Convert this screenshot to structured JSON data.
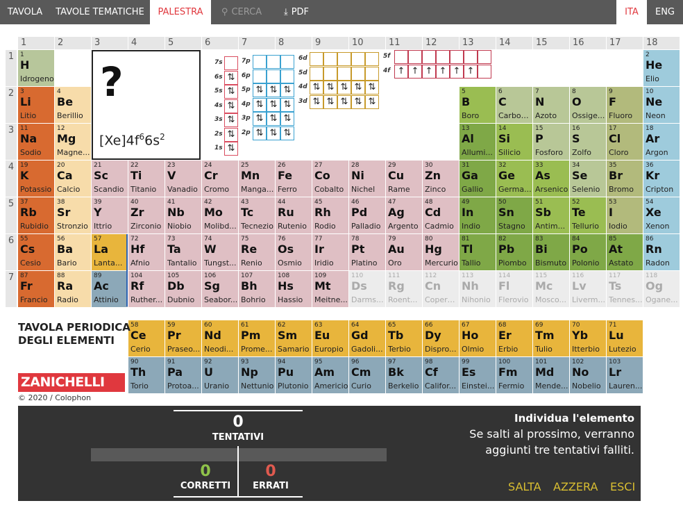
{
  "nav": {
    "items": [
      {
        "label": "TAVOLA"
      },
      {
        "label": "TAVOLE TEMATICHE"
      },
      {
        "label": "PALESTRA"
      },
      {
        "label": "CERCA"
      },
      {
        "label": "PDF"
      }
    ],
    "lang": [
      "ITA",
      "ENG"
    ]
  },
  "columns": [
    "1",
    "2",
    "3",
    "4",
    "5",
    "6",
    "7",
    "8",
    "9",
    "10",
    "11",
    "12",
    "13",
    "14",
    "15",
    "16",
    "17",
    "18"
  ],
  "rows": [
    "1",
    "2",
    "3",
    "4",
    "5",
    "6",
    "7"
  ],
  "question": {
    "mark": "?",
    "config": "[Xe]4f",
    "config_sup1": "6",
    "config_mid": "6s",
    "config_sup2": "2"
  },
  "orbitals": {
    "s": [
      "7s",
      "6s",
      "5s",
      "4s",
      "3s",
      "2s",
      "1s"
    ],
    "p": [
      "7p",
      "6p",
      "5p",
      "4p",
      "3p",
      "2p"
    ],
    "d": [
      "6d",
      "5d",
      "4d",
      "3d"
    ],
    "f": [
      "5f",
      "4f"
    ],
    "pair": "⇅",
    "up": "↑"
  },
  "elements": [
    {
      "z": "1",
      "s": "H",
      "n": "Idrogeno",
      "r": 1,
      "c": 1,
      "k": "hy"
    },
    {
      "z": "2",
      "s": "He",
      "n": "Elio",
      "r": 1,
      "c": 18,
      "k": "ng"
    },
    {
      "z": "3",
      "s": "Li",
      "n": "Litio",
      "r": 2,
      "c": 1,
      "k": "alk"
    },
    {
      "z": "4",
      "s": "Be",
      "n": "Berillio",
      "r": 2,
      "c": 2,
      "k": "ea"
    },
    {
      "z": "5",
      "s": "B",
      "n": "Boro",
      "r": 2,
      "c": 13,
      "k": "pm"
    },
    {
      "z": "6",
      "s": "C",
      "n": "Carbonio",
      "r": 2,
      "c": 14,
      "k": "ml"
    },
    {
      "z": "7",
      "s": "N",
      "n": "Azoto",
      "r": 2,
      "c": 15,
      "k": "ml"
    },
    {
      "z": "8",
      "s": "O",
      "n": "Ossige...",
      "r": 2,
      "c": 16,
      "k": "ml"
    },
    {
      "z": "9",
      "s": "F",
      "n": "Fluoro",
      "r": 2,
      "c": 17,
      "k": "hal"
    },
    {
      "z": "10",
      "s": "Ne",
      "n": "Neon",
      "r": 2,
      "c": 18,
      "k": "ng"
    },
    {
      "z": "11",
      "s": "Na",
      "n": "Sodio",
      "r": 3,
      "c": 1,
      "k": "alk"
    },
    {
      "z": "12",
      "s": "Mg",
      "n": "Magne...",
      "r": 3,
      "c": 2,
      "k": "ea"
    },
    {
      "z": "13",
      "s": "Al",
      "n": "Allumi...",
      "r": 3,
      "c": 13,
      "k": "nm"
    },
    {
      "z": "14",
      "s": "Si",
      "n": "Silicio",
      "r": 3,
      "c": 14,
      "k": "pm"
    },
    {
      "z": "15",
      "s": "P",
      "n": "Fosforo",
      "r": 3,
      "c": 15,
      "k": "ml"
    },
    {
      "z": "16",
      "s": "S",
      "n": "Zolfo",
      "r": 3,
      "c": 16,
      "k": "ml"
    },
    {
      "z": "17",
      "s": "Cl",
      "n": "Cloro",
      "r": 3,
      "c": 17,
      "k": "hal"
    },
    {
      "z": "18",
      "s": "Ar",
      "n": "Argon",
      "r": 3,
      "c": 18,
      "k": "ng"
    },
    {
      "z": "19",
      "s": "K",
      "n": "Potassio",
      "r": 4,
      "c": 1,
      "k": "alk"
    },
    {
      "z": "20",
      "s": "Ca",
      "n": "Calcio",
      "r": 4,
      "c": 2,
      "k": "ea"
    },
    {
      "z": "21",
      "s": "Sc",
      "n": "Scandio",
      "r": 4,
      "c": 3,
      "k": "tm"
    },
    {
      "z": "22",
      "s": "Ti",
      "n": "Titanio",
      "r": 4,
      "c": 4,
      "k": "tm"
    },
    {
      "z": "23",
      "s": "V",
      "n": "Vanadio",
      "r": 4,
      "c": 5,
      "k": "tm"
    },
    {
      "z": "24",
      "s": "Cr",
      "n": "Cromo",
      "r": 4,
      "c": 6,
      "k": "tm"
    },
    {
      "z": "25",
      "s": "Mn",
      "n": "Manga...",
      "r": 4,
      "c": 7,
      "k": "tm"
    },
    {
      "z": "26",
      "s": "Fe",
      "n": "Ferro",
      "r": 4,
      "c": 8,
      "k": "tm"
    },
    {
      "z": "27",
      "s": "Co",
      "n": "Cobalto",
      "r": 4,
      "c": 9,
      "k": "tm"
    },
    {
      "z": "28",
      "s": "Ni",
      "n": "Nichel",
      "r": 4,
      "c": 10,
      "k": "tm"
    },
    {
      "z": "29",
      "s": "Cu",
      "n": "Rame",
      "r": 4,
      "c": 11,
      "k": "tm"
    },
    {
      "z": "30",
      "s": "Zn",
      "n": "Zinco",
      "r": 4,
      "c": 12,
      "k": "tm"
    },
    {
      "z": "31",
      "s": "Ga",
      "n": "Gallio",
      "r": 4,
      "c": 13,
      "k": "nm"
    },
    {
      "z": "32",
      "s": "Ge",
      "n": "Germa...",
      "r": 4,
      "c": 14,
      "k": "pm"
    },
    {
      "z": "33",
      "s": "As",
      "n": "Arsenico",
      "r": 4,
      "c": 15,
      "k": "pm"
    },
    {
      "z": "34",
      "s": "Se",
      "n": "Selenio",
      "r": 4,
      "c": 16,
      "k": "ml"
    },
    {
      "z": "35",
      "s": "Br",
      "n": "Bromo",
      "r": 4,
      "c": 17,
      "k": "hal"
    },
    {
      "z": "36",
      "s": "Kr",
      "n": "Cripton",
      "r": 4,
      "c": 18,
      "k": "ng"
    },
    {
      "z": "37",
      "s": "Rb",
      "n": "Rubidio",
      "r": 5,
      "c": 1,
      "k": "alk"
    },
    {
      "z": "38",
      "s": "Sr",
      "n": "Stronzio",
      "r": 5,
      "c": 2,
      "k": "ea"
    },
    {
      "z": "39",
      "s": "Y",
      "n": "Ittrio",
      "r": 5,
      "c": 3,
      "k": "tm"
    },
    {
      "z": "40",
      "s": "Zr",
      "n": "Zirconio",
      "r": 5,
      "c": 4,
      "k": "tm"
    },
    {
      "z": "41",
      "s": "Nb",
      "n": "Niobio",
      "r": 5,
      "c": 5,
      "k": "tm"
    },
    {
      "z": "42",
      "s": "Mo",
      "n": "Molibd...",
      "r": 5,
      "c": 6,
      "k": "tm"
    },
    {
      "z": "43",
      "s": "Tc",
      "n": "Tecnezio",
      "r": 5,
      "c": 7,
      "k": "tm"
    },
    {
      "z": "44",
      "s": "Ru",
      "n": "Rutenio",
      "r": 5,
      "c": 8,
      "k": "tm"
    },
    {
      "z": "45",
      "s": "Rh",
      "n": "Rodio",
      "r": 5,
      "c": 9,
      "k": "tm"
    },
    {
      "z": "46",
      "s": "Pd",
      "n": "Palladio",
      "r": 5,
      "c": 10,
      "k": "tm"
    },
    {
      "z": "47",
      "s": "Ag",
      "n": "Argento",
      "r": 5,
      "c": 11,
      "k": "tm"
    },
    {
      "z": "48",
      "s": "Cd",
      "n": "Cadmio",
      "r": 5,
      "c": 12,
      "k": "tm"
    },
    {
      "z": "49",
      "s": "In",
      "n": "Indio",
      "r": 5,
      "c": 13,
      "k": "nm"
    },
    {
      "z": "50",
      "s": "Sn",
      "n": "Stagno",
      "r": 5,
      "c": 14,
      "k": "nm"
    },
    {
      "z": "51",
      "s": "Sb",
      "n": "Antim...",
      "r": 5,
      "c": 15,
      "k": "pm"
    },
    {
      "z": "52",
      "s": "Te",
      "n": "Tellurio",
      "r": 5,
      "c": 16,
      "k": "pm"
    },
    {
      "z": "53",
      "s": "I",
      "n": "Iodio",
      "r": 5,
      "c": 17,
      "k": "hal"
    },
    {
      "z": "54",
      "s": "Xe",
      "n": "Xenon",
      "r": 5,
      "c": 18,
      "k": "ng"
    },
    {
      "z": "55",
      "s": "Cs",
      "n": "Cesio",
      "r": 6,
      "c": 1,
      "k": "alk"
    },
    {
      "z": "56",
      "s": "Ba",
      "n": "Bario",
      "r": 6,
      "c": 2,
      "k": "ea"
    },
    {
      "z": "57",
      "s": "La",
      "n": "Lanta...",
      "r": 6,
      "c": 3,
      "k": "lan"
    },
    {
      "z": "72",
      "s": "Hf",
      "n": "Afnio",
      "r": 6,
      "c": 4,
      "k": "tm"
    },
    {
      "z": "73",
      "s": "Ta",
      "n": "Tantalio",
      "r": 6,
      "c": 5,
      "k": "tm"
    },
    {
      "z": "74",
      "s": "W",
      "n": "Tungst...",
      "r": 6,
      "c": 6,
      "k": "tm"
    },
    {
      "z": "75",
      "s": "Re",
      "n": "Renio",
      "r": 6,
      "c": 7,
      "k": "tm"
    },
    {
      "z": "76",
      "s": "Os",
      "n": "Osmio",
      "r": 6,
      "c": 8,
      "k": "tm"
    },
    {
      "z": "77",
      "s": "Ir",
      "n": "Iridio",
      "r": 6,
      "c": 9,
      "k": "tm"
    },
    {
      "z": "78",
      "s": "Pt",
      "n": "Platino",
      "r": 6,
      "c": 10,
      "k": "tm"
    },
    {
      "z": "79",
      "s": "Au",
      "n": "Oro",
      "r": 6,
      "c": 11,
      "k": "tm"
    },
    {
      "z": "80",
      "s": "Hg",
      "n": "Mercurio",
      "r": 6,
      "c": 12,
      "k": "tm"
    },
    {
      "z": "81",
      "s": "Tl",
      "n": "Tallio",
      "r": 6,
      "c": 13,
      "k": "nm"
    },
    {
      "z": "82",
      "s": "Pb",
      "n": "Piombo",
      "r": 6,
      "c": 14,
      "k": "nm"
    },
    {
      "z": "83",
      "s": "Bi",
      "n": "Bismuto",
      "r": 6,
      "c": 15,
      "k": "nm"
    },
    {
      "z": "84",
      "s": "Po",
      "n": "Polonio",
      "r": 6,
      "c": 16,
      "k": "nm"
    },
    {
      "z": "85",
      "s": "At",
      "n": "Astato",
      "r": 6,
      "c": 17,
      "k": "nm"
    },
    {
      "z": "86",
      "s": "Rn",
      "n": "Radon",
      "r": 6,
      "c": 18,
      "k": "ng"
    },
    {
      "z": "87",
      "s": "Fr",
      "n": "Francio",
      "r": 7,
      "c": 1,
      "k": "alk"
    },
    {
      "z": "88",
      "s": "Ra",
      "n": "Radio",
      "r": 7,
      "c": 2,
      "k": "ea"
    },
    {
      "z": "89",
      "s": "Ac",
      "n": "Attinio",
      "r": 7,
      "c": 3,
      "k": "act"
    },
    {
      "z": "104",
      "s": "Rf",
      "n": "Ruther...",
      "r": 7,
      "c": 4,
      "k": "tm"
    },
    {
      "z": "105",
      "s": "Db",
      "n": "Dubnio",
      "r": 7,
      "c": 5,
      "k": "tm"
    },
    {
      "z": "106",
      "s": "Sg",
      "n": "Seabor...",
      "r": 7,
      "c": 6,
      "k": "tm"
    },
    {
      "z": "107",
      "s": "Bh",
      "n": "Bohrio",
      "r": 7,
      "c": 7,
      "k": "tm"
    },
    {
      "z": "108",
      "s": "Hs",
      "n": "Hassio",
      "r": 7,
      "c": 8,
      "k": "tm"
    },
    {
      "z": "109",
      "s": "Mt",
      "n": "Meitne...",
      "r": 7,
      "c": 9,
      "k": "tm"
    },
    {
      "z": "110",
      "s": "Ds",
      "n": "Darms...",
      "r": 7,
      "c": 10,
      "k": "sy"
    },
    {
      "z": "111",
      "s": "Rg",
      "n": "Roent...",
      "r": 7,
      "c": 11,
      "k": "sy"
    },
    {
      "z": "112",
      "s": "Cn",
      "n": "Copern...",
      "r": 7,
      "c": 12,
      "k": "sy"
    },
    {
      "z": "113",
      "s": "Nh",
      "n": "Nihonio",
      "r": 7,
      "c": 13,
      "k": "sy"
    },
    {
      "z": "114",
      "s": "Fl",
      "n": "Flerovio",
      "r": 7,
      "c": 14,
      "k": "sy"
    },
    {
      "z": "115",
      "s": "Mc",
      "n": "Mosco...",
      "r": 7,
      "c": 15,
      "k": "sy"
    },
    {
      "z": "116",
      "s": "Lv",
      "n": "Liverm...",
      "r": 7,
      "c": 16,
      "k": "sy"
    },
    {
      "z": "117",
      "s": "Ts",
      "n": "Tennes...",
      "r": 7,
      "c": 17,
      "k": "sy"
    },
    {
      "z": "118",
      "s": "Og",
      "n": "Ogane...",
      "r": 7,
      "c": 18,
      "k": "sy"
    },
    {
      "z": "58",
      "s": "Ce",
      "n": "Cerio",
      "r": 9,
      "c": 4,
      "k": "lan"
    },
    {
      "z": "59",
      "s": "Pr",
      "n": "Praseo...",
      "r": 9,
      "c": 5,
      "k": "lan"
    },
    {
      "z": "60",
      "s": "Nd",
      "n": "Neodi...",
      "r": 9,
      "c": 6,
      "k": "lan"
    },
    {
      "z": "61",
      "s": "Pm",
      "n": "Prome...",
      "r": 9,
      "c": 7,
      "k": "lan"
    },
    {
      "z": "62",
      "s": "Sm",
      "n": "Samario",
      "r": 9,
      "c": 8,
      "k": "lan"
    },
    {
      "z": "63",
      "s": "Eu",
      "n": "Europio",
      "r": 9,
      "c": 9,
      "k": "lan"
    },
    {
      "z": "64",
      "s": "Gd",
      "n": "Gadoli...",
      "r": 9,
      "c": 10,
      "k": "lan"
    },
    {
      "z": "65",
      "s": "Tb",
      "n": "Terbio",
      "r": 9,
      "c": 11,
      "k": "lan"
    },
    {
      "z": "66",
      "s": "Dy",
      "n": "Dispro...",
      "r": 9,
      "c": 12,
      "k": "lan"
    },
    {
      "z": "67",
      "s": "Ho",
      "n": "Olmio",
      "r": 9,
      "c": 13,
      "k": "lan"
    },
    {
      "z": "68",
      "s": "Er",
      "n": "Erbio",
      "r": 9,
      "c": 14,
      "k": "lan"
    },
    {
      "z": "69",
      "s": "Tm",
      "n": "Tulio",
      "r": 9,
      "c": 15,
      "k": "lan"
    },
    {
      "z": "70",
      "s": "Yb",
      "n": "Itterbio",
      "r": 9,
      "c": 16,
      "k": "lan"
    },
    {
      "z": "71",
      "s": "Lu",
      "n": "Lutezio",
      "r": 9,
      "c": 17,
      "k": "lan"
    },
    {
      "z": "90",
      "s": "Th",
      "n": "Torio",
      "r": 10,
      "c": 4,
      "k": "act"
    },
    {
      "z": "91",
      "s": "Pa",
      "n": "Protoa...",
      "r": 10,
      "c": 5,
      "k": "act"
    },
    {
      "z": "92",
      "s": "U",
      "n": "Uranio",
      "r": 10,
      "c": 6,
      "k": "act"
    },
    {
      "z": "93",
      "s": "Np",
      "n": "Nettunio",
      "r": 10,
      "c": 7,
      "k": "act"
    },
    {
      "z": "94",
      "s": "Pu",
      "n": "Plutonio",
      "r": 10,
      "c": 8,
      "k": "act"
    },
    {
      "z": "95",
      "s": "Am",
      "n": "Americio",
      "r": 10,
      "c": 9,
      "k": "act"
    },
    {
      "z": "96",
      "s": "Cm",
      "n": "Curio",
      "r": 10,
      "c": 10,
      "k": "act"
    },
    {
      "z": "97",
      "s": "Bk",
      "n": "Berkelio",
      "r": 10,
      "c": 11,
      "k": "act"
    },
    {
      "z": "98",
      "s": "Cf",
      "n": "Califor...",
      "r": 10,
      "c": 12,
      "k": "act"
    },
    {
      "z": "99",
      "s": "Es",
      "n": "Einstei...",
      "r": 10,
      "c": 13,
      "k": "act"
    },
    {
      "z": "100",
      "s": "Fm",
      "n": "Fermio",
      "r": 10,
      "c": 14,
      "k": "act"
    },
    {
      "z": "101",
      "s": "Md",
      "n": "Mende...",
      "r": 10,
      "c": 15,
      "k": "act"
    },
    {
      "z": "102",
      "s": "No",
      "n": "Nobelio",
      "r": 10,
      "c": 16,
      "k": "act"
    },
    {
      "z": "103",
      "s": "Lr",
      "n": "Lauren...",
      "r": 10,
      "c": 17,
      "k": "act"
    }
  ],
  "title": "TAVOLA PERIODICA\nDEGLI ELEMENTI",
  "brand": "ZANICHELLI",
  "copyright": "© 2020 / Colophon",
  "game": {
    "attempts": "0",
    "attempts_label": "TENTATIVI",
    "correct": "0",
    "correct_label": "CORRETTI",
    "wrong": "0",
    "wrong_label": "ERRATI",
    "title": "Individua l'elemento",
    "message": "Se salti al prossimo, verranno aggiunti tre tentativi falliti.",
    "actions": [
      "SALTA",
      "AZZERA",
      "ESCI"
    ],
    "correct_color": "#8fc34a",
    "wrong_color": "#e05a4f"
  }
}
